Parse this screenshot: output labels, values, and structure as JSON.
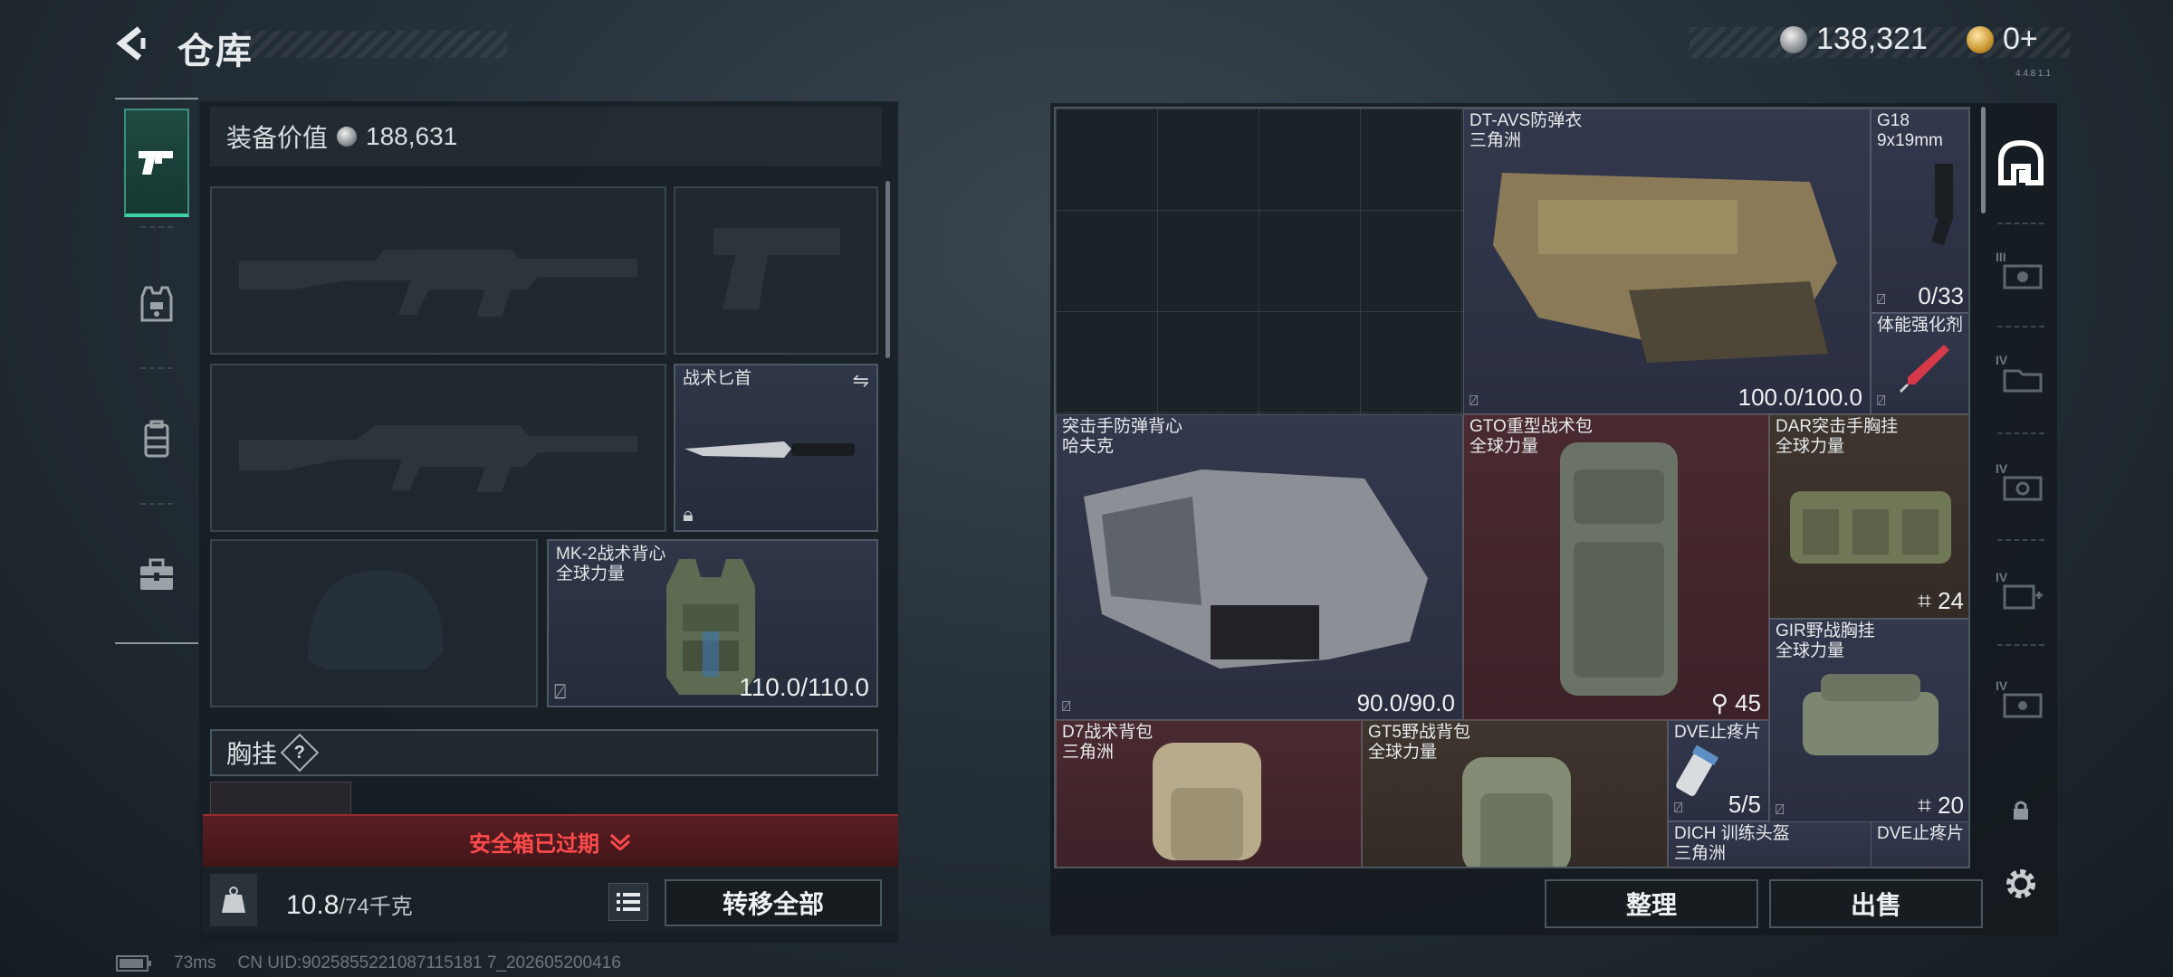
{
  "header": {
    "title": "仓库"
  },
  "currency": {
    "silver": "138,321",
    "gold": "0+"
  },
  "version_text": "4.4.8 1.1",
  "equipment": {
    "value_label": "装备价值",
    "value": "188,631",
    "melee": {
      "name": "战术匕首"
    },
    "vest": {
      "name": "MK-2战术背心",
      "map": "全球力量",
      "durability": "110.0/110.0"
    },
    "chest_rig_label": "胸挂",
    "chest_rig_help": "?",
    "safebox_expired": "安全箱已过期",
    "weight_current": "10.8",
    "weight_max": "/74千克",
    "transfer_all": "转移全部"
  },
  "status": {
    "ping": "73ms",
    "uid": "CN UID:9025855221087115181 7_202605200416"
  },
  "storage": {
    "items": [
      {
        "name": "DT-AVS防弹衣",
        "map": "三角洲",
        "value": "100.0/100.0"
      },
      {
        "name": "G18",
        "map": "9x19mm",
        "value": "0/33"
      },
      {
        "name": "体能强化剂",
        "map": ""
      },
      {
        "name": "突击手防弹背心",
        "map": "哈夫克",
        "value": "90.0/90.0"
      },
      {
        "name": "GTO重型战术包",
        "map": "全球力量",
        "value": "45"
      },
      {
        "name": "DAR突击手胸挂",
        "map": "全球力量",
        "value": "24"
      },
      {
        "name": "GIR野战胸挂",
        "map": "全球力量",
        "value": "20"
      },
      {
        "name": "D7战术背包",
        "map": "三角洲"
      },
      {
        "name": "GT5野战背包",
        "map": "全球力量"
      },
      {
        "name": "DVE止疼片",
        "map": "",
        "value": "5/5"
      },
      {
        "name": "DICH 训练头盔",
        "map": "三角洲"
      },
      {
        "name": "DVE止疼片",
        "map": ""
      }
    ],
    "sort_button": "整理",
    "sell_button": "出售",
    "side_tabs": [
      "III",
      "IV",
      "IV",
      "IV",
      "IV"
    ]
  },
  "icons": {
    "back": "back-arrow-icon",
    "pistol": "pistol-icon",
    "armor": "armor-icon",
    "backpack": "backpack-icon",
    "toolbox": "toolbox-icon",
    "safe": "safebox-icon",
    "settings": "gear-icon",
    "lock": "lock-icon"
  },
  "colors": {
    "accent_green": "#3fd0a6",
    "expired_red": "#ff4b4b",
    "rarity_blue": "#33384d",
    "rarity_red": "#4a2a30",
    "rarity_brown": "#3e352e"
  }
}
